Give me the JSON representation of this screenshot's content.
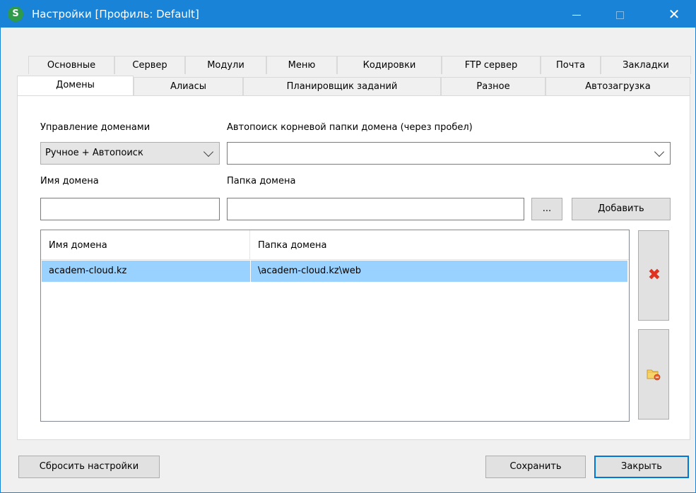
{
  "window": {
    "app_icon_letter": "S",
    "title": "Настройки [Профиль: Default]"
  },
  "tabs": {
    "row1": [
      "Основные",
      "Сервер",
      "Модули",
      "Меню",
      "Кодировки",
      "FTP сервер",
      "Почта",
      "Закладки"
    ],
    "row2": [
      "Домены",
      "Алиасы",
      "Планировщик заданий",
      "Разное",
      "Автозагрузка"
    ],
    "active": "Домены"
  },
  "domains": {
    "management_label": "Управление доменами",
    "management_value": "Ручное + Автопоиск",
    "autosearch_label": "Автопоиск корневой папки домена (через пробел)",
    "autosearch_value": "",
    "domain_name_label": "Имя домена",
    "domain_name_value": "",
    "domain_folder_label": "Папка домена",
    "domain_folder_value": "",
    "browse_label": "...",
    "add_label": "Добавить",
    "table": {
      "columns": [
        "Имя домена",
        "Папка домена"
      ],
      "rows": [
        [
          "academ-cloud.kz",
          "\\academ-cloud.kz\\web"
        ]
      ]
    }
  },
  "footer": {
    "reset_label": "Сбросить настройки",
    "save_label": "Сохранить",
    "close_label": "Закрыть"
  },
  "colors": {
    "titlebar": "#1883d7",
    "selection": "#99d1ff",
    "delete_icon": "#e03020"
  }
}
